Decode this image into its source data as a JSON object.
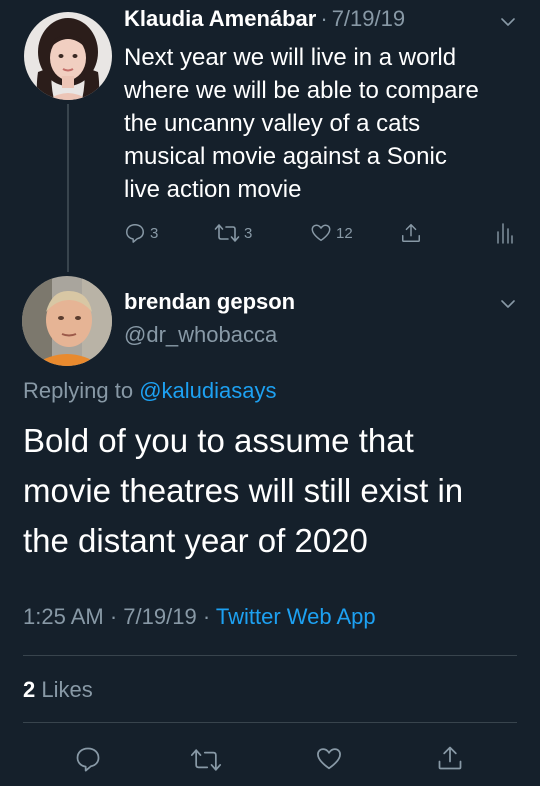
{
  "tweet1": {
    "author_name": "Klaudia Amenábar",
    "separator": "·",
    "date": "7/19/19",
    "text": "Next year we will live in a world\nwhere we will be able to compare\nthe uncanny valley of a cats\nmusical movie against a Sonic\nlive action movie",
    "reply_count": "3",
    "retweet_count": "3",
    "like_count": "12"
  },
  "tweet2": {
    "author_name": "brendan gepson",
    "handle": "@dr_whobacca",
    "replying_prefix": "Replying to",
    "replying_handle": "@kaludiasays",
    "text": "Bold of you to assume that\nmovie theatres will still exist in\nthe distant year of 2020",
    "time": "1:25 AM",
    "sep1": "·",
    "date": "7/19/19",
    "sep2": "·",
    "source": "Twitter Web App",
    "likes_count": "2",
    "likes_label": "Likes"
  },
  "colors": {
    "background": "#15202b",
    "muted": "#8899a6",
    "link": "#1da1f2",
    "divider": "#38444d"
  },
  "icons": [
    "chevron-down-icon",
    "reply-icon",
    "retweet-icon",
    "like-icon",
    "share-icon",
    "analytics-icon"
  ]
}
